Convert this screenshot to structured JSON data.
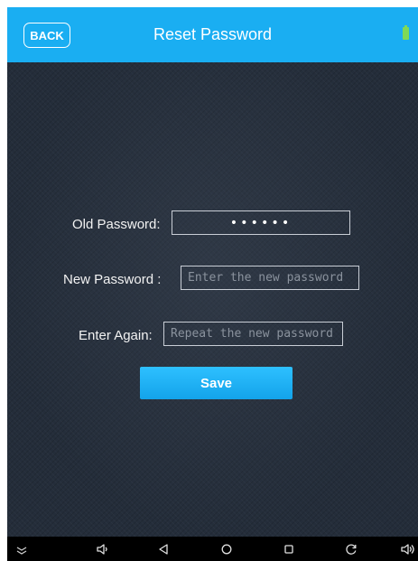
{
  "header": {
    "back_label": "BACK",
    "title": "Reset Password"
  },
  "form": {
    "old_password": {
      "label": "Old Password:",
      "value": "••••••"
    },
    "new_password": {
      "label": "New  Password :",
      "placeholder": "Enter the new password"
    },
    "repeat_password": {
      "label": "Enter Again:",
      "placeholder": "Repeat the new password"
    },
    "save_label": "Save"
  },
  "status": {
    "battery_icon": "battery-icon",
    "battery_color": "#7ed957"
  },
  "navbar": {
    "icons": [
      "swipe-up-icon",
      "volume-down-icon",
      "back-icon",
      "home-icon",
      "recents-icon",
      "rotate-icon",
      "volume-up-icon"
    ]
  },
  "colors": {
    "accent": "#1aaef2",
    "background": "#1f2835",
    "button": "#1aa9ef"
  }
}
